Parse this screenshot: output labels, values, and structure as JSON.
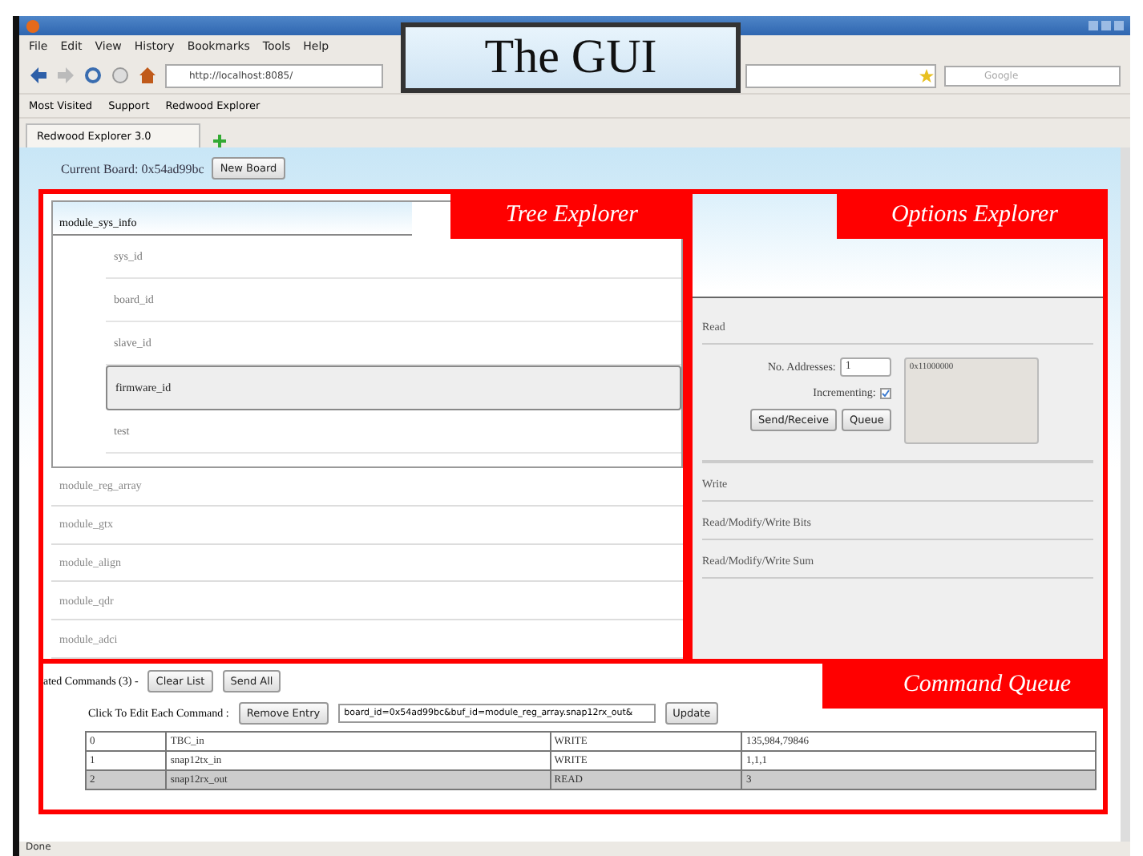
{
  "browser": {
    "menu": [
      "File",
      "Edit",
      "View",
      "History",
      "Bookmarks",
      "Tools",
      "Help"
    ],
    "url": "http://localhost:8085/",
    "search_placeholder": "Google",
    "bookmarks": [
      "Most Visited",
      "Support",
      "Redwood Explorer"
    ],
    "tabs": [
      {
        "label": "Redwood Explorer 3.0",
        "selected": true
      }
    ],
    "status": "Done"
  },
  "overlay_title": "The GUI",
  "board": {
    "label": "Current Board: 0x54ad99bc",
    "button": "New Board"
  },
  "tree": {
    "annotation": "Tree Explorer",
    "items": [
      {
        "label": "module_sys_info",
        "expanded": true,
        "children": [
          {
            "label": "sys_id",
            "selected": false
          },
          {
            "label": "board_id",
            "selected": false
          },
          {
            "label": "slave_id",
            "selected": false
          },
          {
            "label": "firmware_id",
            "selected": true
          },
          {
            "label": "test",
            "selected": false
          }
        ]
      },
      {
        "label": "module_reg_array",
        "expanded": false
      },
      {
        "label": "module_gtx",
        "expanded": false
      },
      {
        "label": "module_align",
        "expanded": false
      },
      {
        "label": "module_qdr",
        "expanded": false
      },
      {
        "label": "module_adci",
        "expanded": false
      }
    ]
  },
  "options": {
    "annotation": "Options Explorer",
    "sections": [
      {
        "title": "Read",
        "expanded": true,
        "addresses_label": "No. Addresses:",
        "addresses_value": "1",
        "incrementing_label": "Incrementing:",
        "incrementing_checked": true,
        "buttons": [
          "Send/Receive",
          "Queue"
        ],
        "output": "0x11000000"
      },
      {
        "title": "Write",
        "expanded": false
      },
      {
        "title": "Read/Modify/Write Bits",
        "expanded": false
      },
      {
        "title": "Read/Modify/Write Sum",
        "expanded": false
      }
    ]
  },
  "queue": {
    "annotation": "Command Queue",
    "title": "ated Commands (3) -",
    "buttons": [
      "Clear List",
      "Send All"
    ],
    "edit_label": "Click To Edit Each Command :",
    "remove_button": "Remove Entry",
    "edit_value": "board_id=0x54ad99bc&buf_id=module_reg_array.snap12rx_out&",
    "update_button": "Update",
    "rows": [
      {
        "index": "0",
        "name": "TBC_in",
        "op": "WRITE",
        "value": "135,984,79846",
        "selected": false
      },
      {
        "index": "1",
        "name": "snap12tx_in",
        "op": "WRITE",
        "value": "1,1,1",
        "selected": false
      },
      {
        "index": "2",
        "name": "snap12rx_out",
        "op": "READ",
        "value": "3",
        "selected": true
      }
    ]
  }
}
